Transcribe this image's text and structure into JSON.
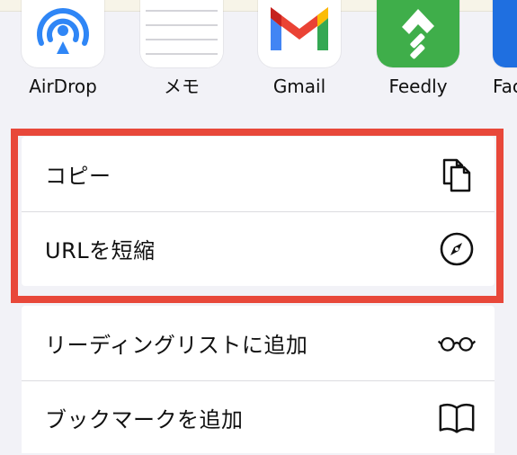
{
  "apps": [
    {
      "key": "airdrop",
      "label": "AirDrop",
      "icon": "airdrop-icon",
      "color": "#2f86f6"
    },
    {
      "key": "memo",
      "label": "メモ",
      "icon": "notes-icon",
      "color": "#d9d9de"
    },
    {
      "key": "gmail",
      "label": "Gmail",
      "icon": "gmail-icon",
      "color": "#ea4335"
    },
    {
      "key": "feedly",
      "label": "Feedly",
      "icon": "feedly-icon",
      "color": "#3fae4a"
    },
    {
      "key": "partial",
      "label": "Fac",
      "icon": "app-icon",
      "color": "#1f6fe0"
    }
  ],
  "actions_group_1": [
    {
      "label": "コピー",
      "icon": "copy-icon"
    },
    {
      "label": "URLを短縮",
      "icon": "compass-icon"
    }
  ],
  "actions_group_2": [
    {
      "label": "リーディングリストに追加",
      "icon": "glasses-icon"
    },
    {
      "label": "ブックマークを追加",
      "icon": "book-icon"
    }
  ],
  "colors": {
    "highlight": "#e8483a",
    "background": "#f2f2f7"
  }
}
